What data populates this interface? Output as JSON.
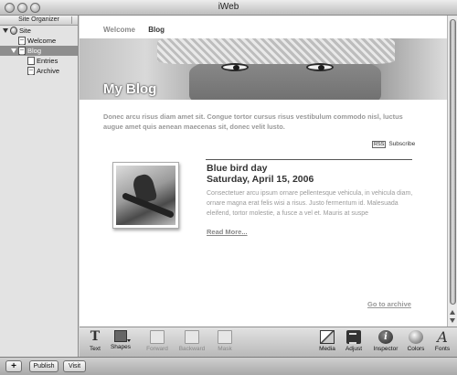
{
  "window": {
    "title": "iWeb"
  },
  "sidebar": {
    "header": "Site Organizer",
    "items": [
      {
        "label": "Site",
        "icon": "globe-icon"
      },
      {
        "label": "Welcome",
        "icon": "page-icon"
      },
      {
        "label": "Blog",
        "icon": "blog-icon",
        "selected": true
      },
      {
        "label": "Entries",
        "icon": "entries-icon"
      },
      {
        "label": "Archive",
        "icon": "archive-icon"
      }
    ]
  },
  "bottom_bar": {
    "add_label": "+",
    "publish_label": "Publish",
    "visit_label": "Visit"
  },
  "page": {
    "nav": [
      "Welcome",
      "Blog"
    ],
    "active_nav": "Blog",
    "hero_title": "My Blog",
    "intro": "Donec arcu risus diam amet sit. Congue tortor cursus risus vestibulum commodo nisl, luctus augue amet quis aenean maecenas sit, donec velit lusto.",
    "rss_badge": "RSS",
    "rss_label": "Subscribe",
    "post": {
      "title": "Blue bird day",
      "date": "Saturday, April 15, 2006",
      "body": "Consectetuer arcu ipsum ornare pellentesque vehicula, in vehicula diam, ornare magna erat felis wisi a risus. Justo fermentum id. Malesuada eleifend, tortor molestie, a fusce a vel et. Mauris at suspe",
      "read_more": "Read More..."
    },
    "archive_link": "Go to archive"
  },
  "toolbar": {
    "items": [
      {
        "label": "Text",
        "icon": "text-icon",
        "enabled": true
      },
      {
        "label": "Shapes",
        "icon": "shapes-icon",
        "enabled": true
      },
      {
        "label": "Forward",
        "icon": "bring-forward-icon",
        "enabled": false
      },
      {
        "label": "Backward",
        "icon": "send-backward-icon",
        "enabled": false
      },
      {
        "label": "Mask",
        "icon": "mask-icon",
        "enabled": false
      },
      {
        "label": "Media",
        "icon": "media-icon",
        "enabled": true
      },
      {
        "label": "Adjust",
        "icon": "adjust-icon",
        "enabled": true
      },
      {
        "label": "Inspector",
        "icon": "inspector-icon",
        "enabled": true
      },
      {
        "label": "Colors",
        "icon": "colors-icon",
        "enabled": true
      },
      {
        "label": "Fonts",
        "icon": "fonts-icon",
        "enabled": true
      }
    ]
  }
}
